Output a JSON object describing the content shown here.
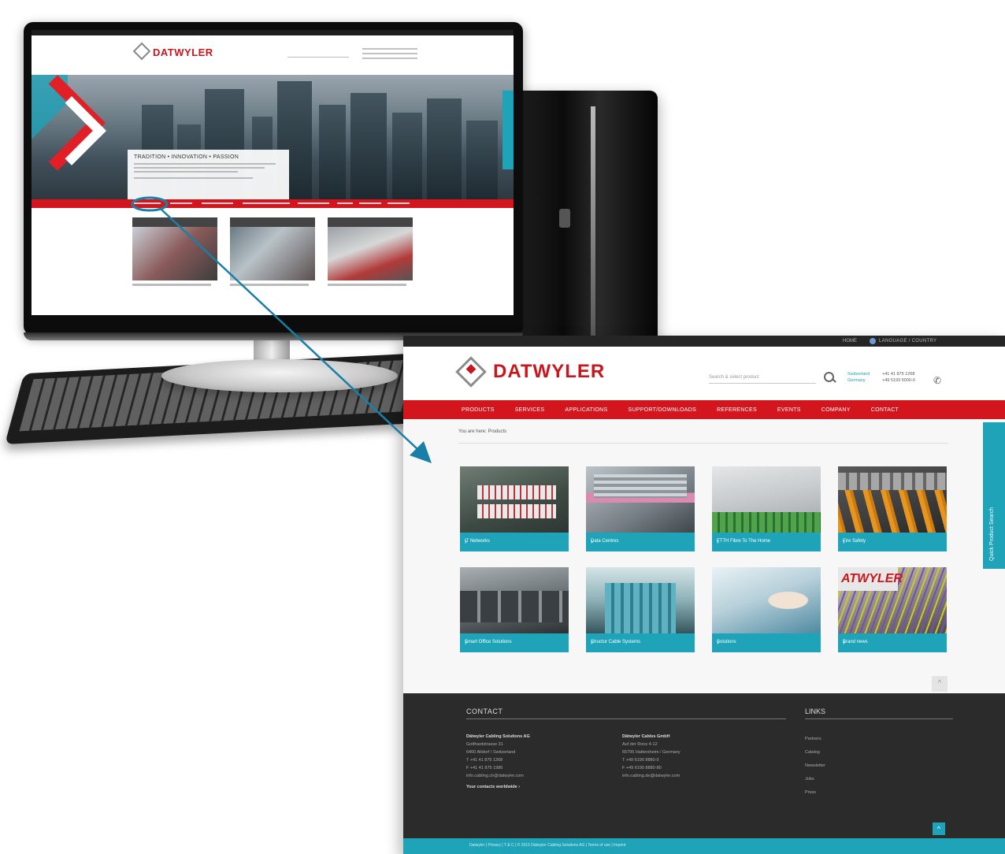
{
  "site": {
    "logo_text": "DATWYLER"
  },
  "mini": {
    "tagline": "TRADITION • INNOVATION • PASSION"
  },
  "topbar": {
    "home": "HOME",
    "language": "LANGUAGE / COUNTRY"
  },
  "header": {
    "search_placeholder": "Search & select product",
    "phones": [
      {
        "label": "Switzerland",
        "number": "+41 41 875 1268"
      },
      {
        "label": "Germany",
        "number": "+49 5193 5000-0"
      }
    ]
  },
  "nav": {
    "items": [
      "PRODUCTS",
      "SERVICES",
      "APPLICATIONS",
      "SUPPORT/DOWNLOADS",
      "REFERENCES",
      "EVENTS",
      "COMPANY",
      "CONTACT"
    ]
  },
  "breadcrumb": "You are here: Products",
  "products": [
    {
      "label": "IT Networks"
    },
    {
      "label": "Data Centres"
    },
    {
      "label": "FTTH Fibre To The Home"
    },
    {
      "label": "Fire Safety"
    },
    {
      "label": "Smart Office Solutions"
    },
    {
      "label": "Structur Cable Systems"
    },
    {
      "label": "Solutions"
    },
    {
      "label": "Brand news"
    }
  ],
  "quick_search": "Quick Product Search",
  "footer": {
    "contact_title": "CONTACT",
    "links_title": "LINKS",
    "col1": {
      "company": "Dätwyler Cabling Solutions AG",
      "street": "Gotthardstrasse 31",
      "city": "6460 Altdorf / Switzerland",
      "phone": "T +41 41 875 1268",
      "fax": "F +41 41 875 1986",
      "email": "info.cabling.ch@datwyler.com",
      "more": "Your contacts worldwide ›"
    },
    "col2": {
      "company": "Dätwyler Cables GmbH",
      "street": "Auf der Roos 4-12",
      "city": "65795 Hattersheim / Germany",
      "phone": "T +49 6190 8880-0",
      "fax": "F +49 6190 8880-80",
      "email": "info.cabling.de@datwyler.com"
    },
    "links": [
      "Partners",
      "Catalog",
      "Newsletter",
      "Jobs",
      "Press"
    ],
    "legal": "Datwyler  |  Privacy  |  T & C  |  © 2015 Dätwyler Cabling Solutions AG  |  Terms of use  |  Imprint"
  },
  "colors": {
    "brand_red": "#d3161e",
    "teal": "#1fa3b8",
    "footer_dark": "#2b2b2b"
  }
}
